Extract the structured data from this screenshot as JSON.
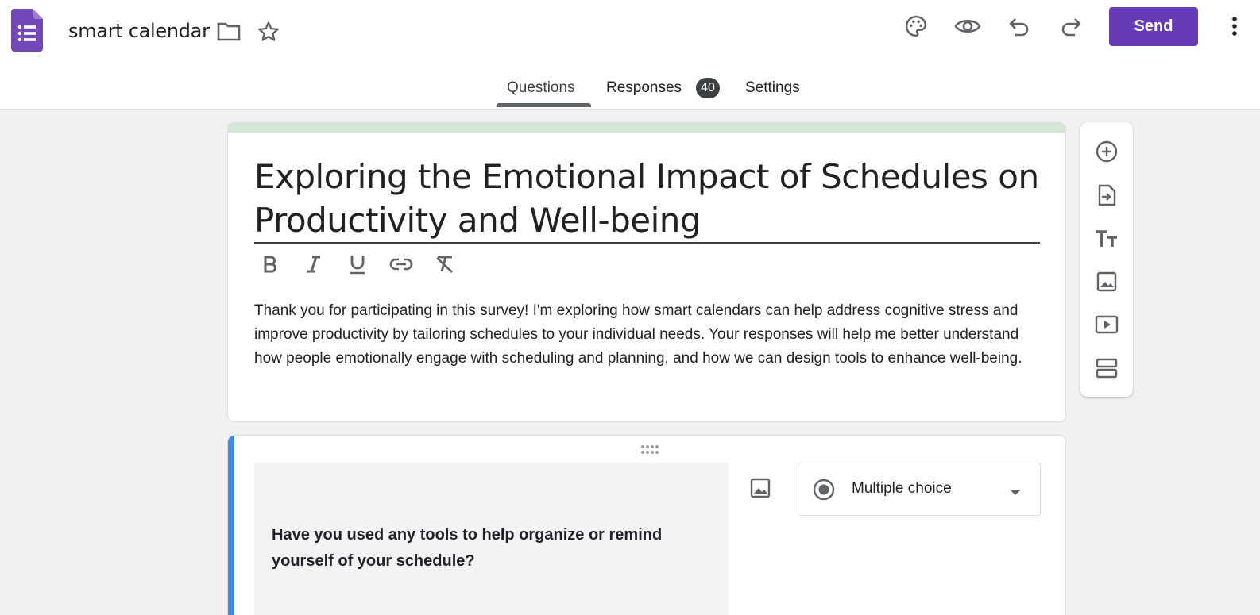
{
  "header": {
    "doc_title": "smart calendar",
    "send_label": "Send",
    "icons": [
      "forms-logo-icon",
      "folder-icon",
      "star-icon",
      "palette-icon",
      "preview-eye-icon",
      "undo-icon",
      "redo-icon",
      "more-vert-icon"
    ]
  },
  "tabs": {
    "questions": "Questions",
    "responses": "Responses",
    "responses_count": "40",
    "settings": "Settings",
    "active": "Questions"
  },
  "form": {
    "title": "Exploring the Emotional Impact of Schedules on Productivity and Well-being",
    "description": "Thank you for participating in this survey! I'm exploring how smart calendars can help address cognitive stress and improve productivity by tailoring schedules to your individual needs. Your responses will help me better understand how people emotionally engage with scheduling and planning, and how we can design tools to enhance well-being.",
    "format_buttons": [
      "bold-icon",
      "italic-icon",
      "underline-icon",
      "link-icon",
      "clear-format-icon"
    ]
  },
  "side_toolbar": [
    "add-question-icon",
    "import-questions-icon",
    "add-title-icon",
    "add-image-icon",
    "add-video-icon",
    "add-section-icon"
  ],
  "question": {
    "text": "Have you used any tools to help organize or remind yourself of your schedule?",
    "type": "Multiple choice"
  },
  "colors": {
    "accent": "#673ab7",
    "header_band": "#d6e6d4",
    "question_bar": "#4285f4",
    "background": "#f0f2f1"
  }
}
